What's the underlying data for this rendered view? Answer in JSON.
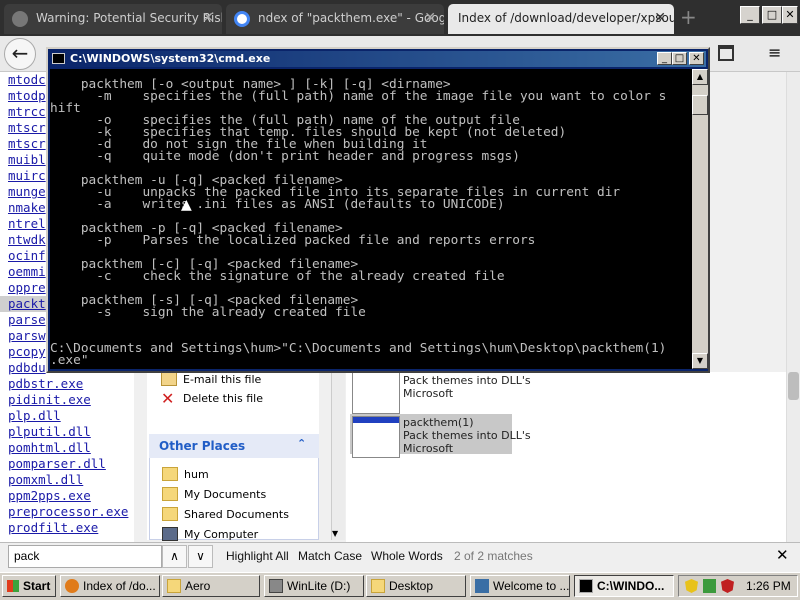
{
  "browser": {
    "tabs": [
      {
        "label": "Warning: Potential Security Risk A"
      },
      {
        "label": "ndex of \"packthem.exe\" - Googl"
      },
      {
        "label": "Index of /download/developer/xpsour"
      }
    ],
    "window_buttons": {
      "minimize": "_",
      "maximize": "□",
      "close": "✕"
    }
  },
  "file_list": [
    {
      "name": "mtodc"
    },
    {
      "name": "mtodp"
    },
    {
      "name": "mtrcc"
    },
    {
      "name": "mtscr"
    },
    {
      "name": "mtscr"
    },
    {
      "name": "muibl"
    },
    {
      "name": "muirc"
    },
    {
      "name": "munge"
    },
    {
      "name": "nmake"
    },
    {
      "name": "ntrel"
    },
    {
      "name": "ntwdk"
    },
    {
      "name": "ocinf"
    },
    {
      "name": "oemmi"
    },
    {
      "name": "oppre"
    },
    {
      "name": "packt",
      "highlighted": true
    },
    {
      "name": "parse"
    },
    {
      "name": "parsw"
    },
    {
      "name": "pcopy"
    },
    {
      "name": "pdbdu"
    },
    {
      "name": "pdbstr.exe"
    },
    {
      "name": "pidinit.exe"
    },
    {
      "name": "plp.dll"
    },
    {
      "name": "plputil.dll"
    },
    {
      "name": "pomhtml.dll"
    },
    {
      "name": "pomparser.dll"
    },
    {
      "name": "pomxml.dll"
    },
    {
      "name": "ppm2pps.exe"
    },
    {
      "name": "preprocessor.exe"
    },
    {
      "name": "prodfilt.exe"
    }
  ],
  "explorer": {
    "tasks": [
      "E-mail this file",
      "Delete this file"
    ],
    "other_places": {
      "title": "Other Places",
      "items": [
        "hum",
        "My Documents",
        "Shared Documents",
        "My Computer"
      ]
    },
    "files": [
      {
        "line1": "Pack themes into DLL's",
        "line2": "Microsoft"
      },
      {
        "line0": "packthem(1)",
        "line1": "Pack themes into DLL's",
        "line2": "Microsoft"
      }
    ]
  },
  "cmd": {
    "title": "C:\\WINDOWS\\system32\\cmd.exe",
    "text": "    packthem [-o <output name> ] [-k] [-q] <dirname>\n      -m    specifies the (full path) name of the image file you want to color s\nhift\n      -o    specifies the (full path) name of the output file\n      -k    specifies that temp. files should be kept (not deleted)\n      -d    do not sign the file when building it\n      -q    quite mode (don't print header and progress msgs)\n\n    packthem -u [-q] <packed filename>\n      -u    unpacks the packed file into its separate files in current dir\n      -a    writes .ini files as ANSI (defaults to UNICODE)\n\n    packthem -p [-q] <packed filename>\n      -p    Parses the localized packed file and reports errors\n\n    packthem [-c] [-q] <packed filename>\n      -c    check the signature of the already created file\n\n    packthem [-s] [-q] <packed filename>\n      -s    sign the already created file\n\n\nC:\\Documents and Settings\\hum>\"C:\\Documents and Settings\\hum\\Desktop\\packthem(1)\n.exe\""
  },
  "findbar": {
    "query": "pack",
    "highlight_all": "Highlight All",
    "match_case": "Match Case",
    "whole_words": "Whole Words",
    "status": "2 of 2 matches",
    "close": "✕"
  },
  "taskbar": {
    "start": "Start",
    "buttons": [
      {
        "label": "Index of /do..."
      },
      {
        "label": "Aero"
      },
      {
        "label": "WinLite (D:)"
      },
      {
        "label": "Desktop"
      },
      {
        "label": "Welcome to ..."
      },
      {
        "label": "C:\\WINDO...",
        "active": true
      }
    ],
    "clock": "1:26 PM"
  }
}
